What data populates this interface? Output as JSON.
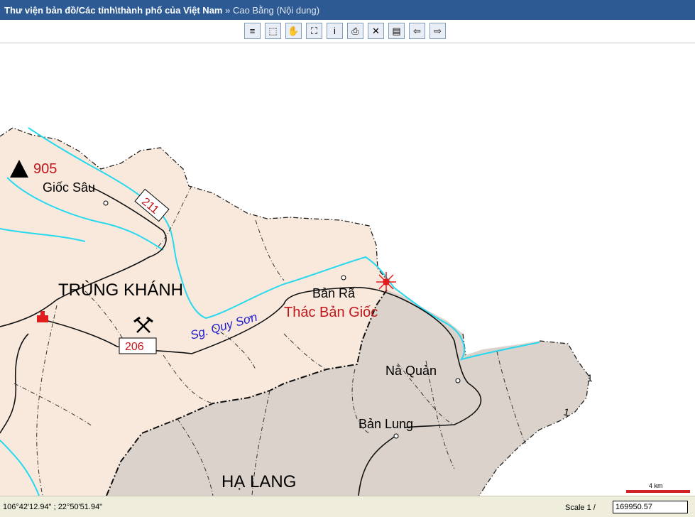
{
  "title": {
    "path": "Thư viện bản đồ/Các tỉnh\\thành phố của Việt Nam",
    "separator": "»",
    "current": "Cao Bằng (Nội dung)"
  },
  "toolbar": {
    "buttons": [
      {
        "name": "layers-button",
        "icon": "layers-icon",
        "glyph": "≡"
      },
      {
        "name": "zoom-select-button",
        "icon": "zoom-select-icon",
        "glyph": "⬚"
      },
      {
        "name": "pan-button",
        "icon": "hand-icon",
        "glyph": "✋"
      },
      {
        "name": "full-extent-button",
        "icon": "full-extent-icon",
        "glyph": "⛶"
      },
      {
        "name": "info-button",
        "icon": "info-icon",
        "glyph": "i"
      },
      {
        "name": "print-button",
        "icon": "printer-icon",
        "glyph": "⎙"
      },
      {
        "name": "clear-button",
        "icon": "clear-icon",
        "glyph": "✕"
      },
      {
        "name": "legend-button",
        "icon": "book-icon",
        "glyph": "▤"
      },
      {
        "name": "back-button",
        "icon": "arrow-left-icon",
        "glyph": "⇦"
      },
      {
        "name": "forward-button",
        "icon": "arrow-right-icon",
        "glyph": "⇨"
      }
    ]
  },
  "map": {
    "labels": {
      "peak_elev": "905",
      "giocsau": "Giốc Sâu",
      "road_211": "211",
      "trungkhanh": "TRÙNG KHÁNH",
      "banra": "Bản Rã",
      "thac": "Thác Bản Giốc",
      "quyson": "Sg. Quy Sơn",
      "road_206": "206",
      "naquan": "Nà Quản",
      "banlung": "Bản Lung",
      "halang": "HẠ LANG",
      "border_mark_1": "1",
      "border_mark_2": "1"
    },
    "scale_bar": "4 km",
    "colors": {
      "land_light": "#f9e9dc",
      "land_grey": "#dbd3cb",
      "river": "#27d9ef",
      "river_label": "#1c1ccc",
      "label_red": "#c0161c",
      "scalebar": "#d0202a"
    }
  },
  "status": {
    "coordinates": "106°42'12.94\" ; 22°50'51.94\"",
    "scale_label": "Scale  1  /",
    "scale_value": "169950.57"
  }
}
